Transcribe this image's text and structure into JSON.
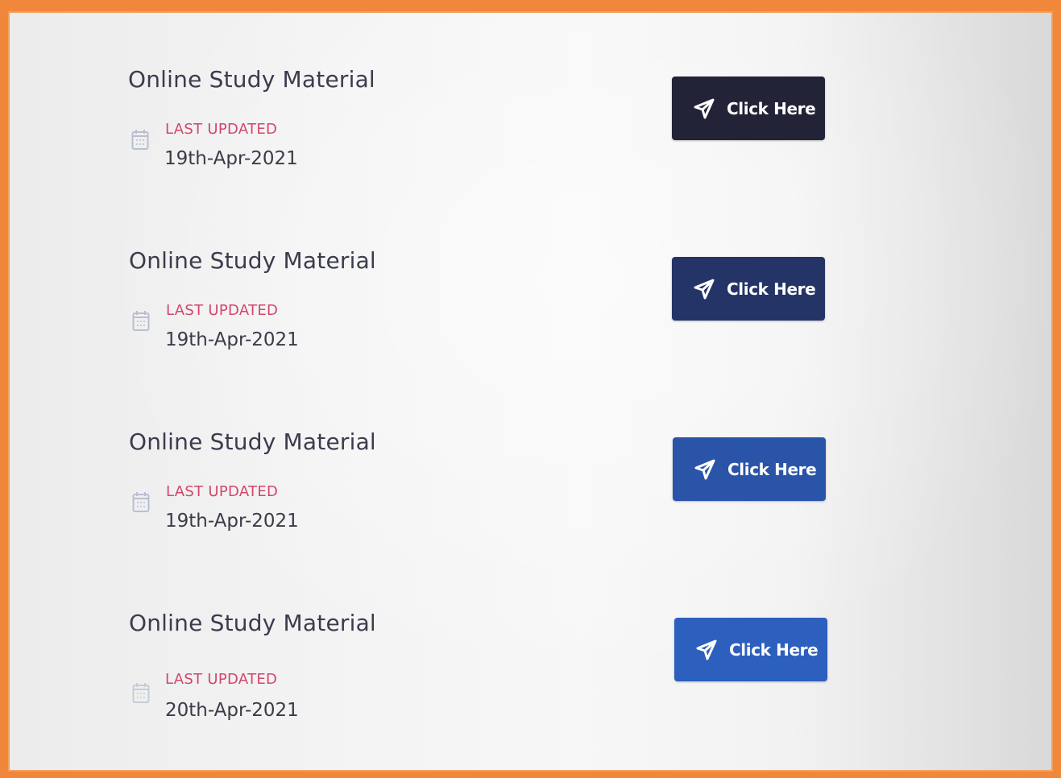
{
  "items": [
    {
      "title": "Online Study Material",
      "updated_label": "LAST UPDATED",
      "updated_date": "19th-Apr-2021",
      "button_label": "Click Here",
      "button_color": "#222337",
      "button_icon": "paper-plane-icon",
      "date_icon": "calendar-icon"
    },
    {
      "title": "Online Study Material",
      "updated_label": "LAST UPDATED",
      "updated_date": "19th-Apr-2021",
      "button_label": "Click Here",
      "button_color": "#243466",
      "button_icon": "paper-plane-icon",
      "date_icon": "calendar-icon"
    },
    {
      "title": "Online Study Material",
      "updated_label": "LAST UPDATED",
      "updated_date": "19th-Apr-2021",
      "button_label": "Click Here",
      "button_color": "#2a54a8",
      "button_icon": "paper-plane-icon",
      "date_icon": "calendar-icon"
    },
    {
      "title": "Online Study Material",
      "updated_label": "LAST UPDATED",
      "updated_date": "20th-Apr-2021",
      "button_label": "Click Here",
      "button_color": "#2c5fbe",
      "button_icon": "paper-plane-icon",
      "date_icon": "calendar-icon"
    }
  ],
  "colors": {
    "frame_border": "#f0873a",
    "updated_label": "#d2466b",
    "title_text": "#3b3c4d"
  }
}
